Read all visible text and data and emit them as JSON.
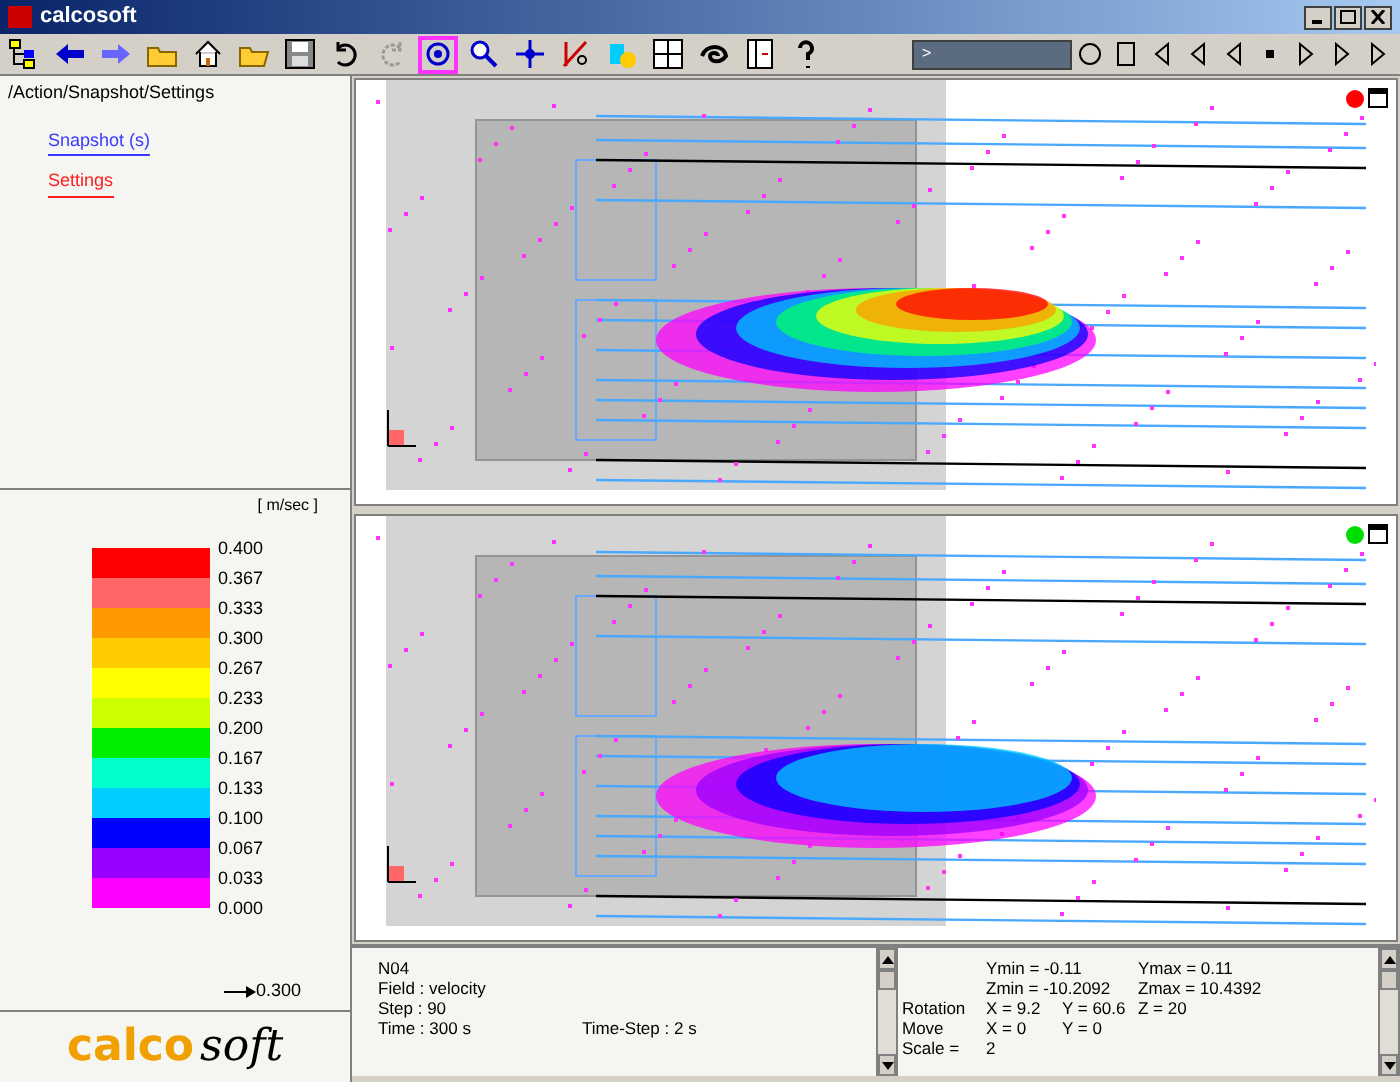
{
  "window": {
    "title": "calcosoft"
  },
  "toolbar": {
    "tools": [
      {
        "selected": false
      },
      {
        "selected": false
      },
      {
        "selected": false
      },
      {
        "selected": false
      },
      {
        "selected": false
      },
      {
        "selected": false
      },
      {
        "selected": false
      },
      {
        "selected": false
      },
      {
        "selected": false
      },
      {
        "selected": true
      },
      {
        "selected": false
      },
      {
        "selected": false
      },
      {
        "selected": false
      },
      {
        "selected": false
      },
      {
        "selected": false
      },
      {
        "selected": false
      },
      {
        "selected": false
      },
      {
        "selected": false
      }
    ],
    "timeline_marker": ">",
    "level": 0
  },
  "navigation": {
    "path": "/Action/Snapshot/Settings",
    "links": [
      {
        "label": "Snapshot (s)",
        "selected": false
      },
      {
        "label": "Settings",
        "selected": true
      }
    ]
  },
  "legend": {
    "unit": "[ m/sec ]",
    "values": [
      "0.400",
      "0.367",
      "0.333",
      "0.300",
      "0.267",
      "0.233",
      "0.200",
      "0.167",
      "0.133",
      "0.100",
      "0.067",
      "0.033",
      "0.000"
    ],
    "bands": [
      {
        "color": "#ff0000"
      },
      {
        "color": "#ff6666"
      },
      {
        "color": "#ff9900"
      },
      {
        "color": "#ffcc00"
      },
      {
        "color": "#ffff00"
      },
      {
        "color": "#ccff00"
      },
      {
        "color": "#00ee00"
      },
      {
        "color": "#00ffcc"
      },
      {
        "color": "#00ccff"
      },
      {
        "color": "#0000ff"
      },
      {
        "color": "#9900ff"
      },
      {
        "color": "#ff00ff"
      }
    ],
    "arrow_reference": "0.300"
  },
  "logo": {
    "part_1": "calco",
    "part_2": "soft"
  },
  "viewports": [
    {
      "color": "#ff0000",
      "colored": true
    },
    {
      "color": "#00dd00",
      "colored": false
    }
  ],
  "info_left": {
    "node": "N04",
    "field": "Field :  velocity",
    "step": "Step : 90",
    "time": "Time : 300 s",
    "time_step": "Time-Step : 2 s"
  },
  "info_right": {
    "ranges": [
      {
        "min": "Ymin = -0.11",
        "max": "Ymax = 0.11"
      },
      {
        "min": "Zmin = -10.2092",
        "max": "Zmax = 10.4392"
      }
    ],
    "rotation": {
      "label": "Rotation",
      "x": "X = 9.2",
      "y": "Y = 60.6",
      "z": "Z = 20"
    },
    "move": {
      "label": "Move",
      "x": "X = 0",
      "y": "Y = 0"
    },
    "scale": {
      "label": "Scale =",
      "value": "2"
    }
  }
}
